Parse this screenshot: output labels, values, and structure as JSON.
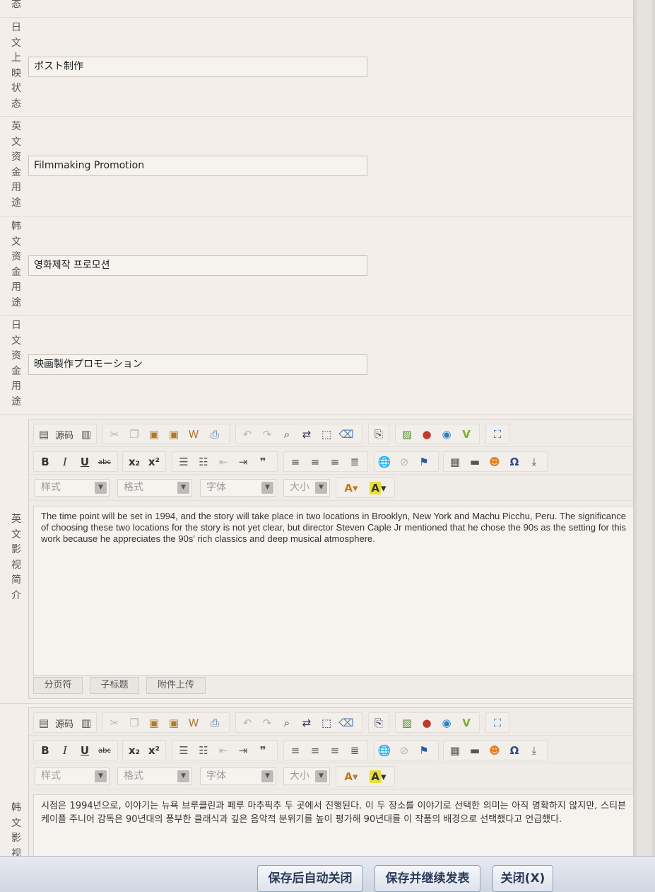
{
  "rows": {
    "cut_label": [
      "态"
    ],
    "jp_status": {
      "label": [
        "日",
        "文",
        "上",
        "映",
        "状",
        "态"
      ],
      "value": "ポスト制作"
    },
    "en_fund": {
      "label": [
        "英",
        "文",
        "资",
        "金",
        "用",
        "途"
      ],
      "value": "Filmmaking Promotion"
    },
    "ko_fund": {
      "label": [
        "韩",
        "文",
        "资",
        "金",
        "用",
        "途"
      ],
      "value": "영화제작 프로모션"
    },
    "jp_fund": {
      "label": [
        "日",
        "文",
        "资",
        "金",
        "用",
        "途"
      ],
      "value": "映画製作プロモーション"
    },
    "en_intro": {
      "label": [
        "英",
        "文",
        "影",
        "视",
        "简",
        "介"
      ]
    },
    "ko_intro": {
      "label": [
        "韩",
        "文",
        "影",
        "视"
      ]
    }
  },
  "toolbar": {
    "source_label": "源码",
    "style_placeholder": "样式",
    "format_placeholder": "格式",
    "font_placeholder": "字体",
    "size_placeholder": "大小",
    "icons_row1": [
      "new-page-icon",
      "source-icon",
      "templates-icon",
      "cut-icon",
      "copy-icon",
      "paste-icon",
      "paste-text-icon",
      "paste-word-icon",
      "print-icon",
      "undo-icon",
      "redo-icon",
      "find-icon",
      "replace-icon",
      "select-all-icon",
      "remove-format-icon",
      "preview-icon",
      "image-icon",
      "flash-icon",
      "media-icon",
      "video-icon",
      "maximize-icon"
    ],
    "icons_row2": [
      "bold-icon",
      "italic-icon",
      "underline-icon",
      "strike-icon",
      "subscript-icon",
      "superscript-icon",
      "numbered-list-icon",
      "bulleted-list-icon",
      "outdent-icon",
      "indent-icon",
      "blockquote-icon",
      "align-left-icon",
      "align-center-icon",
      "align-right-icon",
      "justify-icon",
      "link-icon",
      "unlink-icon",
      "anchor-icon",
      "table-icon",
      "horizontal-rule-icon",
      "smiley-icon",
      "special-char-icon",
      "page-break-icon"
    ]
  },
  "editor_en": {
    "content": "The time point will be set in 1994, and the story will take place in two locations in Brooklyn, New York and Machu Picchu, Peru. The significance of choosing these two locations for the story is not yet clear, but director Steven Caple Jr mentioned that he chose the 90s as the setting for this work because he appreciates the 90s' rich classics and deep musical atmosphere.",
    "footer": [
      "分页符",
      "子标题",
      "附件上传"
    ]
  },
  "editor_ko": {
    "content": "시점은 1994년으로, 이야기는 뉴욕 브루클린과 페루 마추픽추 두 곳에서 진행된다. 이 두 장소를 이야기로 선택한 의미는 아직 명확하지 않지만, 스티븐 케이플 주니어 감독은 90년대의 풍부한 클래식과 깊은 음악적 분위기를 높이 평가해 90년대를 이 작품의 배경으로 선택했다고 언급했다."
  },
  "buttons": {
    "save_close": "保存后自动关闭",
    "save_continue": "保存并继续发表",
    "close": "关闭(X)"
  }
}
